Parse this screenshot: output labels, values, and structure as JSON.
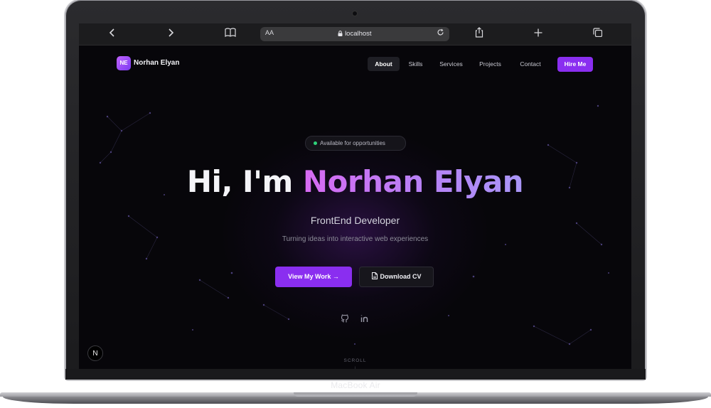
{
  "browser": {
    "back_icon": "chevron-left-icon",
    "forward_icon": "chevron-right-icon",
    "bookmarks_icon": "book-icon",
    "reader_label": "AA",
    "url": "localhost",
    "reload_icon": "reload-icon",
    "share_icon": "share-icon",
    "new_tab_icon": "plus-icon",
    "tabs_icon": "tabs-icon"
  },
  "site": {
    "logo_initials": "NE",
    "logo_name": "Norhan Elyan",
    "nav": [
      "About",
      "Skills",
      "Services",
      "Projects",
      "Contact"
    ],
    "active_nav": "About",
    "hire_label": "Hire Me"
  },
  "hero": {
    "status": "Available for opportunities",
    "greeting": "Hi, I'm",
    "name": "Norhan Elyan",
    "role": "FrontEnd Developer",
    "tagline": "Turning ideas into interactive web experiences",
    "primary_cta": "View My Work →",
    "secondary_cta": "Download CV",
    "scroll_label": "SCROLL",
    "scroll_arrow": "↓"
  },
  "social": [
    "github-icon",
    "linkedin-icon"
  ],
  "dev_badge": "N",
  "device_label": "MacBook Air",
  "colors": {
    "accent": "#8a2ef0",
    "name_gradient_start": "#d76af2",
    "name_gradient_end": "#a996f7",
    "status_dot": "#2fd37a",
    "background": "#07060a"
  }
}
